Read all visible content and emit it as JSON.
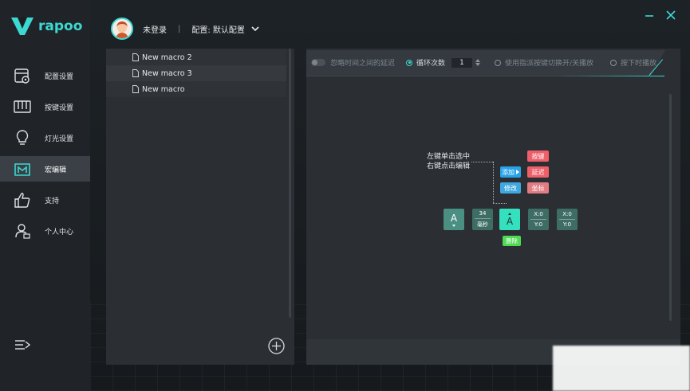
{
  "app": {
    "logo_text": "rapoo"
  },
  "sidebar": {
    "items": [
      {
        "label": "配置设置",
        "icon": "config-icon"
      },
      {
        "label": "按键设置",
        "icon": "keys-icon"
      },
      {
        "label": "灯光设置",
        "icon": "light-bulb-icon"
      },
      {
        "label": "宏编辑",
        "icon": "macro-icon",
        "active": true
      },
      {
        "label": "支持",
        "icon": "thumbs-up-icon"
      },
      {
        "label": "个人中心",
        "icon": "user-center-icon"
      }
    ],
    "menu_icon": "collapse-menu-icon"
  },
  "header": {
    "user_name": "未登录",
    "separator": "|",
    "config_label": "配置: 默认配置",
    "window": {
      "minimize_icon": "minimize-icon",
      "close_icon": "close-icon"
    }
  },
  "macro_list": {
    "items": [
      {
        "name": "New macro 2"
      },
      {
        "name": "New macro 3"
      },
      {
        "name": "New macro"
      }
    ]
  },
  "options": {
    "ignore_delay": "忽略时间之间的延迟",
    "loop_count_label": "循环次数",
    "loop_count_value": "1",
    "toggle_play": "使用指派按键切换开/关播放",
    "hold_play": "按下时播放",
    "selected": "loop_count"
  },
  "editor": {
    "hint_line1": "左键单击选中",
    "hint_line2": "右键点击编辑",
    "add_label": "添加",
    "modify_label": "修改",
    "menu_key": "按键",
    "menu_delay": "延迟",
    "menu_coord": "坐标",
    "delete_label": "删除",
    "tiles": {
      "key1": "A",
      "delay_value": "34",
      "delay_unit": "毫秒",
      "key2": "A",
      "coord1_x": "X:0",
      "coord1_y": "Y:0",
      "coord2_x": "X:0",
      "coord2_y": "Y:0"
    }
  },
  "colors": {
    "accent": "#3bd9d2",
    "red_chip": "#ef5f6a",
    "blue_chip": "#29a3e8",
    "green_chip": "#4edb52",
    "key_tile": "#4b8f83",
    "key_tile_selected": "#35e0bf"
  }
}
